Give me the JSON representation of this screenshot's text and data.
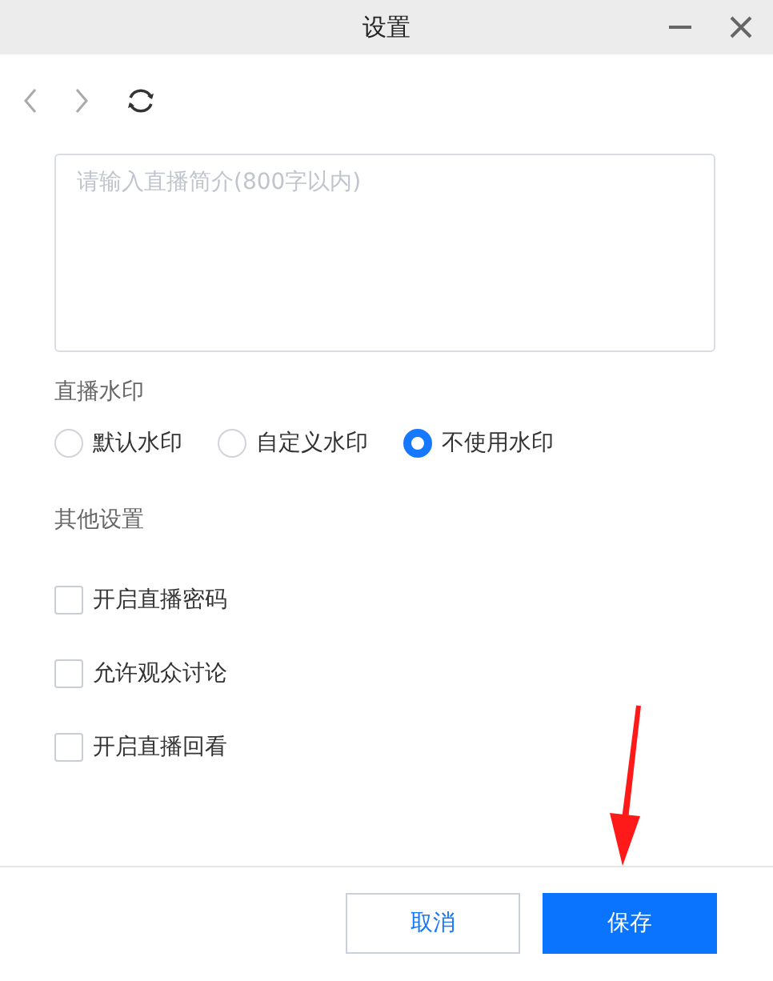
{
  "window": {
    "title": "设置"
  },
  "description": {
    "placeholder": "请输入直播简介(800字以内)"
  },
  "watermark": {
    "label": "直播水印",
    "options": [
      {
        "label": "默认水印",
        "selected": false
      },
      {
        "label": "自定义水印",
        "selected": false
      },
      {
        "label": "不使用水印",
        "selected": true
      }
    ]
  },
  "other_settings": {
    "label": "其他设置",
    "options": [
      {
        "label": "开启直播密码",
        "checked": false
      },
      {
        "label": "允许观众讨论",
        "checked": false
      },
      {
        "label": "开启直播回看",
        "checked": false
      }
    ]
  },
  "buttons": [
    {
      "label": "取消",
      "kind": "secondary"
    },
    {
      "label": "保存",
      "kind": "primary"
    }
  ]
}
